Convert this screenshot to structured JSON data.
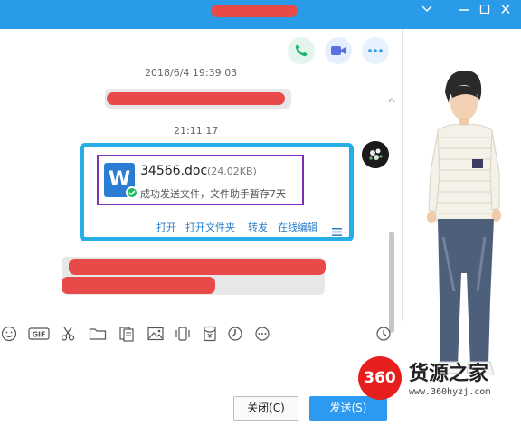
{
  "window": {
    "title": "",
    "controls": [
      "expand",
      "minimize",
      "maximize",
      "close"
    ]
  },
  "chat": {
    "header_actions": [
      {
        "icon": "phone-icon",
        "color": "#1fb46c"
      },
      {
        "icon": "video-camera-icon",
        "color": "#5a6fe0"
      },
      {
        "icon": "more-icon",
        "color": "#2a9be8"
      }
    ],
    "timestamps": [
      "2018/6/4 19:39:03",
      "21:11:17"
    ],
    "file_message": {
      "file_name": "34566.doc",
      "file_size": "(24.02KB)",
      "status": "成功发送文件，文件助手暂存7天",
      "actions": [
        "打开",
        "打开文件夹",
        "转发",
        "在线编辑"
      ],
      "icon": "word-doc-icon",
      "accent_color": "#28aee6",
      "highlight_color": "#7d2fb0"
    }
  },
  "toolbar": {
    "tools": [
      "emoji-icon",
      "gif-icon",
      "scissors-icon",
      "folder-icon",
      "doc-icon",
      "image-icon",
      "shake-icon",
      "red-packet-icon",
      "voice-icon",
      "more-icon"
    ],
    "history_icon": "clock-icon"
  },
  "footer": {
    "close_label": "关闭(C)",
    "send_label": "发送(S)"
  },
  "watermark": {
    "logo_text": "360",
    "name": "货源之家",
    "url": "www.360hyzj.com"
  }
}
